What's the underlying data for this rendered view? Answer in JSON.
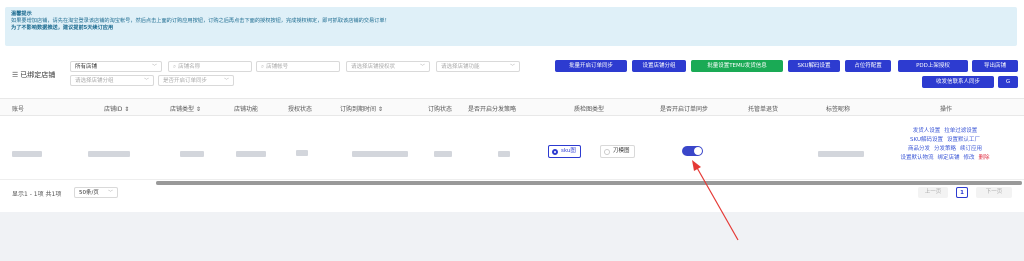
{
  "notice": {
    "title": "温馨提示",
    "line1": "如果要增加店铺，请先在淘宝登录该店铺的淘宝帐号，然后点击上面的订购应用按钮，订购之后再点击下面的授权按钮，完成授权绑定，即可抓取该店铺的交易订单！",
    "line2": "为了不影响数据推送，建议提前5天续订应用"
  },
  "filters": {
    "bound_label": "已绑定店铺",
    "shop_select": "所有店铺",
    "shop_name_ph": "店铺名称",
    "shop_account_ph": "店铺帐号",
    "auth_status_ph": "请选择店铺授权状",
    "func_ph": "请选择店铺功能",
    "group_ph": "请选择店铺分组",
    "order_sync_ph": "是否开启订单同步"
  },
  "buttons": {
    "batch_sync": "批量开启订单同步",
    "set_group": "设置店铺分组",
    "batch_temu": "批量设置TEMU发货信息",
    "sku_decode": "SKU解码设置",
    "placeholder_cfg": "占位符配置",
    "pdd_auth": "PDD上架授权",
    "export": "导出店铺",
    "sender_sync": "收发信联系人同步",
    "refresh": "G"
  },
  "table": {
    "headers": [
      "账号",
      "店铺ID ⇕",
      "店铺类型 ⇕",
      "店铺功能",
      "授权状态",
      "订购到期时间 ⇕",
      "订购状态",
      "是否开启分发策略",
      "质检图类型",
      "是否开启订单同步",
      "托管单退货",
      "标签昵称",
      "操作"
    ],
    "row": {
      "qc_option_sku": "sku图",
      "qc_option_knife": "刀模图",
      "order_sync_on": true,
      "ops": {
        "line1": [
          "发货人设置",
          "拉单过滤设置"
        ],
        "line2": [
          "SKU解码设置",
          "设置默认工厂"
        ],
        "line3": [
          "商品分发",
          "分发策略",
          "续订应用"
        ],
        "line4": [
          "设置默认物流",
          "绑定店铺",
          "修改",
          "删除"
        ]
      }
    }
  },
  "footer": {
    "summary": "显示1 - 1项 共1项",
    "page_size": "50条/页",
    "prev": "上一页",
    "page": "1",
    "next": "下一页"
  }
}
